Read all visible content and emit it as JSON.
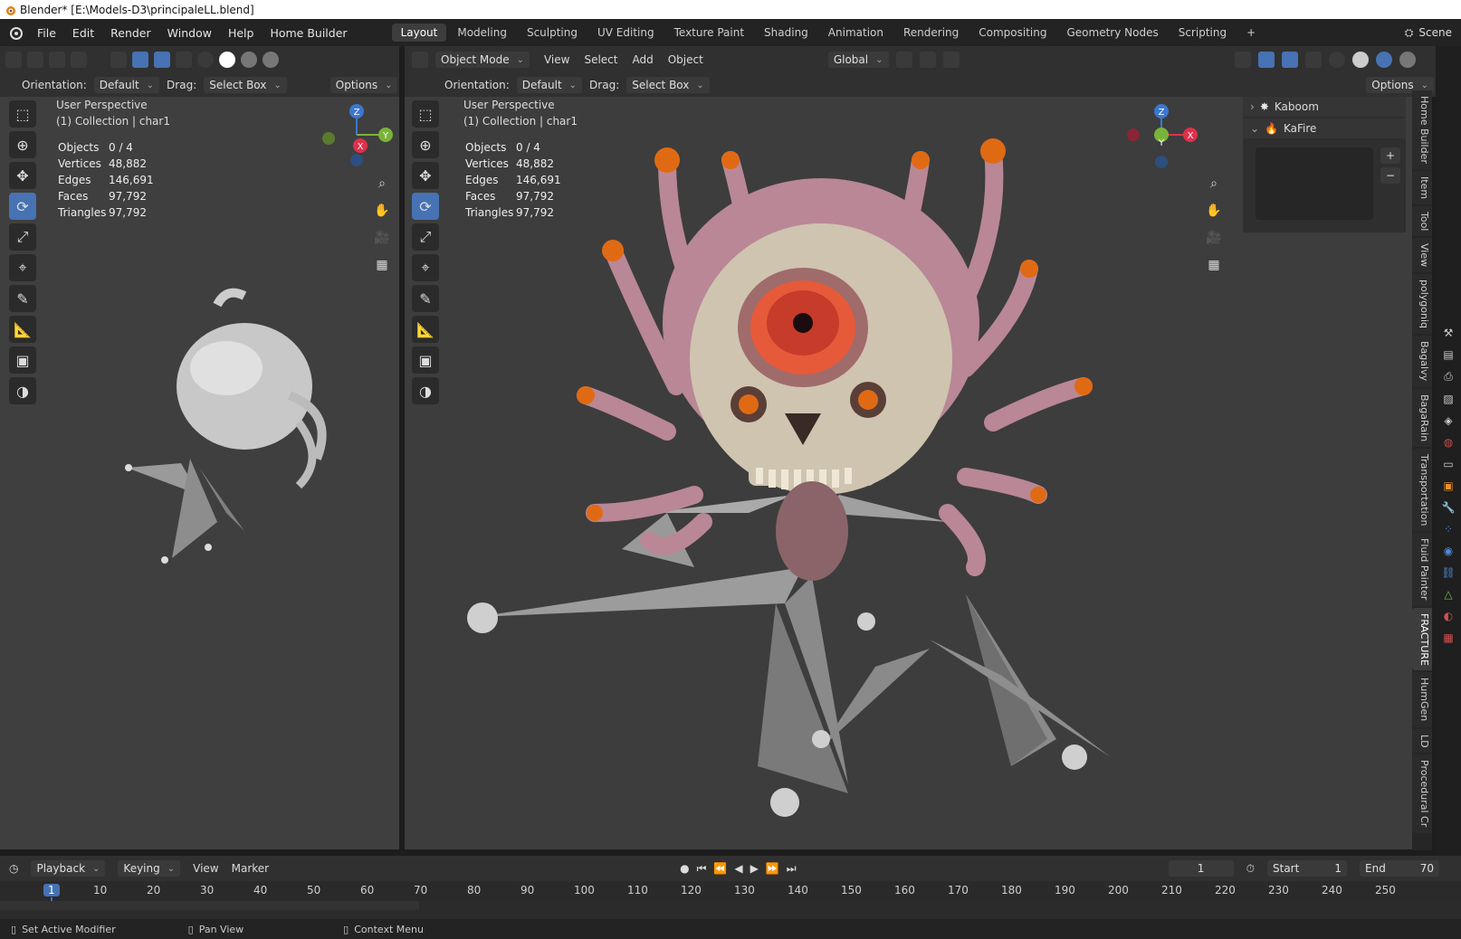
{
  "window": {
    "title": "Blender* [E:\\Models-D3\\principaleLL.blend]"
  },
  "menus": [
    "File",
    "Edit",
    "Render",
    "Window",
    "Help",
    "Home Builder"
  ],
  "workspaces": [
    "Layout",
    "Modeling",
    "Sculpting",
    "UV Editing",
    "Texture Paint",
    "Shading",
    "Animation",
    "Rendering",
    "Compositing",
    "Geometry Nodes",
    "Scripting"
  ],
  "active_workspace": "Layout",
  "scene": "Scene",
  "left_view": {
    "orientation_label": "Orientation:",
    "orientation": "Default",
    "drag_label": "Drag:",
    "drag": "Select Box",
    "options": "Options",
    "perspective": "User Perspective",
    "collection": "(1) Collection | char1",
    "stats": [
      {
        "k": "Objects",
        "v": "0 / 4"
      },
      {
        "k": "Vertices",
        "v": "48,882"
      },
      {
        "k": "Edges",
        "v": "146,691"
      },
      {
        "k": "Faces",
        "v": "97,792"
      },
      {
        "k": "Triangles",
        "v": "97,792"
      }
    ]
  },
  "right_view": {
    "mode": "Object Mode",
    "menu": [
      "View",
      "Select",
      "Add",
      "Object"
    ],
    "transform": "Global",
    "orientation_label": "Orientation:",
    "orientation": "Default",
    "drag_label": "Drag:",
    "drag": "Select Box",
    "options": "Options",
    "perspective": "User Perspective",
    "collection": "(1) Collection | char1",
    "stats": [
      {
        "k": "Objects",
        "v": "0 / 4"
      },
      {
        "k": "Vertices",
        "v": "48,882"
      },
      {
        "k": "Edges",
        "v": "146,691"
      },
      {
        "k": "Faces",
        "v": "97,792"
      },
      {
        "k": "Triangles",
        "v": "97,792"
      }
    ]
  },
  "gizmo": {
    "z": "Z",
    "y": "Y",
    "x": "X"
  },
  "side_panel": {
    "items": [
      "Kaboom",
      "KaFire"
    ]
  },
  "side_tabs": [
    "Home Builder",
    "Item",
    "Tool",
    "View",
    "polygoniq",
    "Bagalvy",
    "BagaRain",
    "Transportation",
    "Fluid Painter",
    "FRACTURE",
    "HumGen",
    "LD",
    "Procedural Cr"
  ],
  "timeline": {
    "menu": [
      "Playback",
      "Keying",
      "View",
      "Marker"
    ],
    "current_frame": "1",
    "start_label": "Start",
    "start": "1",
    "end_label": "End",
    "end": "70",
    "ticks": [
      "1",
      "10",
      "20",
      "30",
      "40",
      "50",
      "60",
      "70",
      "80",
      "90",
      "100",
      "110",
      "120",
      "130",
      "140",
      "150",
      "160",
      "170",
      "180",
      "190",
      "200",
      "210",
      "220",
      "230",
      "240",
      "250"
    ]
  },
  "status": {
    "left": "Set Active Modifier",
    "mid": "Pan View",
    "right": "Context Menu"
  },
  "colors": {
    "accent": "#4772b3",
    "x_axis": "#e0304a",
    "y_axis": "#7ab33a",
    "z_axis": "#3a78d0"
  }
}
